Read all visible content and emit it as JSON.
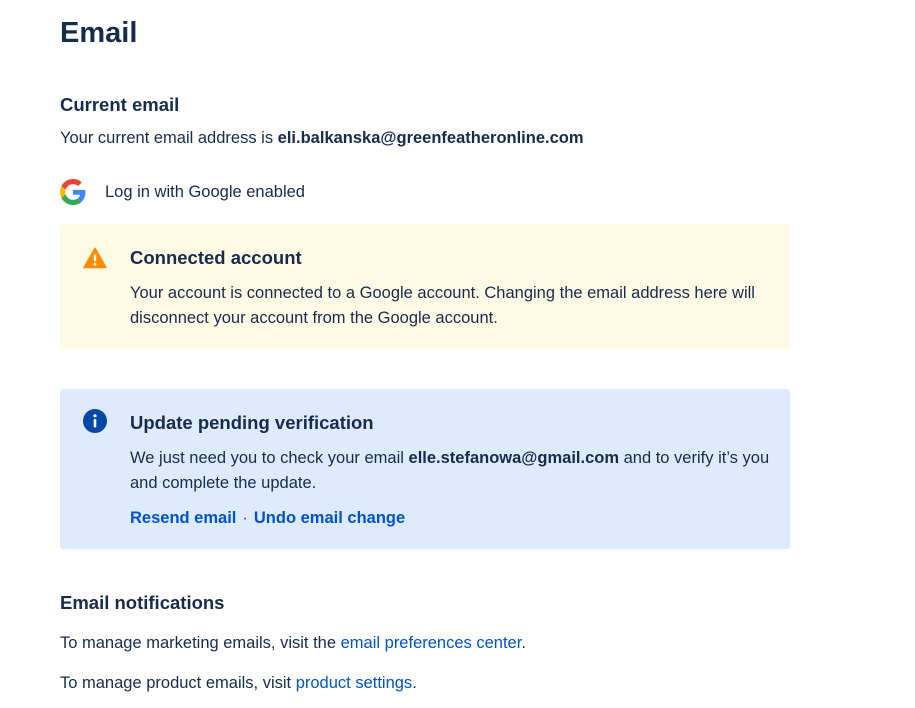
{
  "page": {
    "title": "Email"
  },
  "current_email": {
    "heading": "Current email",
    "prefix": "Your current email address is ",
    "address": "eli.balkanska@greenfeatheronline.com"
  },
  "google_login": {
    "icon": "google-g-icon",
    "label": "Log in with Google enabled"
  },
  "warning_panel": {
    "icon": "warning-icon",
    "title": "Connected account",
    "body": "Your account is connected to a Google account. Changing the email address here will disconnect your account from the Google account.",
    "color": "#fffae6",
    "icon_color": "#ff8b00"
  },
  "info_panel": {
    "icon": "info-icon",
    "title": "Update pending verification",
    "body_prefix": "We just need you to check your email ",
    "body_email": "elle.stefanowa@gmail.com",
    "body_suffix": " and to verify it’s you and complete the update.",
    "resend_label": "Resend email",
    "separator": "·",
    "undo_label": "Undo email change",
    "color": "#deebff",
    "icon_color": "#0747a6"
  },
  "notifications": {
    "heading": "Email notifications",
    "marketing_prefix": "To manage marketing emails, visit the ",
    "marketing_link": "email preferences center",
    "marketing_suffix": ".",
    "product_prefix": "To manage product emails, visit ",
    "product_link": "product settings",
    "product_suffix": "."
  },
  "colors": {
    "text": "#172b4d",
    "link": "#0052cc"
  }
}
